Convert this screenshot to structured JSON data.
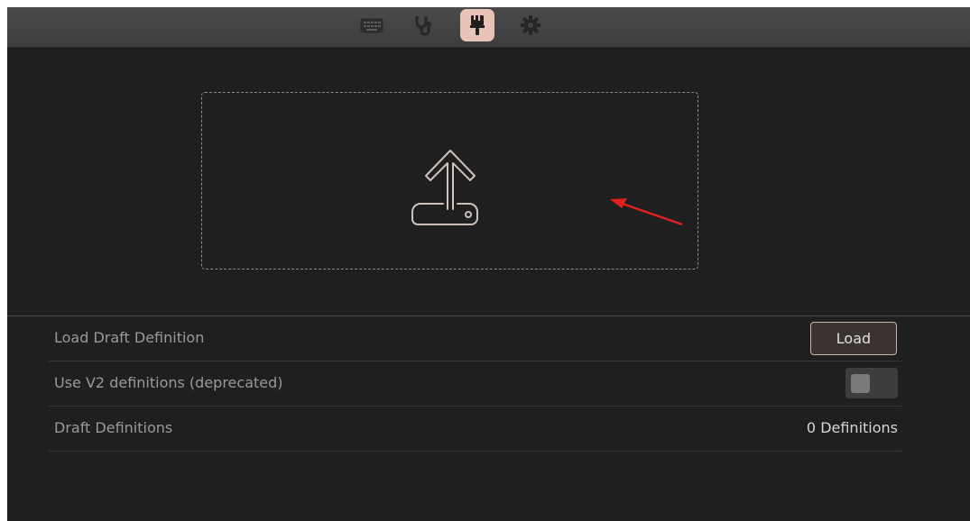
{
  "toolbar": {
    "tabs": [
      {
        "icon": "keyboard-icon",
        "active": false
      },
      {
        "icon": "stethoscope-icon",
        "active": false
      },
      {
        "icon": "paintbrush-icon",
        "active": true
      },
      {
        "icon": "gear-icon",
        "active": false
      }
    ]
  },
  "dropzone": {
    "icon": "upload-icon"
  },
  "settings": {
    "rows": [
      {
        "label": "Load Draft Definition",
        "control": "button",
        "button_label": "Load"
      },
      {
        "label": "Use V2 definitions (deprecated)",
        "control": "toggle",
        "toggle_on": false
      },
      {
        "label": "Draft Definitions",
        "control": "value",
        "value": "0 Definitions"
      }
    ]
  },
  "colors": {
    "background": "#1f1f1f",
    "toolbar": "#424242",
    "active_tab": "#e8c3b6",
    "annotation_arrow": "#e02020",
    "button_border": "#c9b3a8"
  }
}
